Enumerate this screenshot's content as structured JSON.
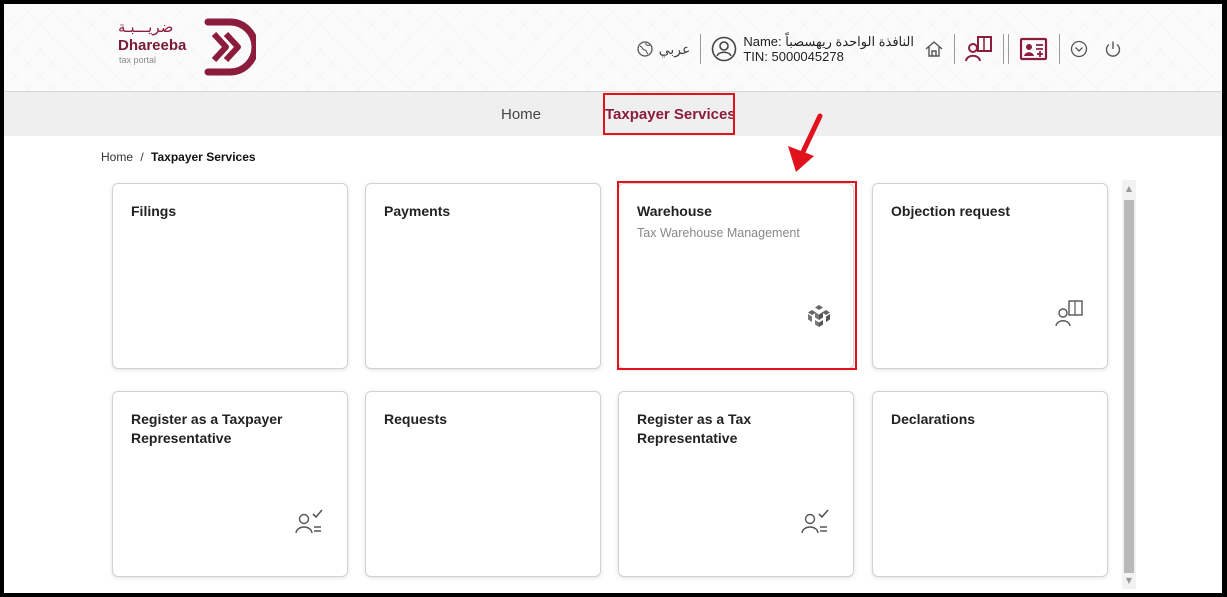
{
  "header": {
    "logo_arabic": "ضريـــبـة",
    "logo_name": "Dhareeba",
    "logo_sub": "tax portal",
    "language": "عربي",
    "user_name": "Name: النافذة الواحدة ريهسصباً",
    "user_tin": "TIN: 5000045278"
  },
  "nav": {
    "items": [
      {
        "label": "Home"
      },
      {
        "label": "Taxpayer Services"
      }
    ]
  },
  "breadcrumb": {
    "home": "Home",
    "separator": "/",
    "current": "Taxpayer Services"
  },
  "cards": [
    {
      "title": "Filings",
      "subtitle": "",
      "icon": "none"
    },
    {
      "title": "Payments",
      "subtitle": "",
      "icon": "none"
    },
    {
      "title": "Warehouse",
      "subtitle": "Tax Warehouse Management",
      "icon": "cube-cluster-icon"
    },
    {
      "title": "Objection request",
      "subtitle": "",
      "icon": "user-book-icon"
    },
    {
      "title": "Register as a Taxpayer Representative",
      "subtitle": "",
      "icon": "user-check-icon"
    },
    {
      "title": "Requests",
      "subtitle": "",
      "icon": "none"
    },
    {
      "title": "Register as a Tax Representative",
      "subtitle": "",
      "icon": "user-check-icon"
    },
    {
      "title": "Declarations",
      "subtitle": "",
      "icon": "none"
    }
  ],
  "colors": {
    "brand": "#8b1c3c",
    "highlight": "#e2121d"
  }
}
